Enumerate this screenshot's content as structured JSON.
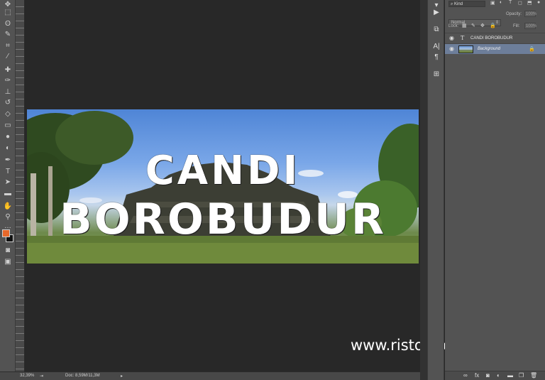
{
  "canvas": {
    "headline_line1": "CANDI",
    "headline_line2": "BOROBUDUR",
    "watermark": "www.ristofa.com"
  },
  "status_bar": {
    "zoom": "32,39%",
    "doc_info": "Doc: 8,59M/11,3M"
  },
  "layers_panel": {
    "filter_kind": "Kind",
    "blend_mode": "Normal",
    "opacity_label": "Opacity:",
    "opacity_value": "100%",
    "lock_label": "Lock:",
    "fill_label": "Fill:",
    "fill_value": "100%",
    "layers": [
      {
        "name": "CANDI BOROBUDUR",
        "type_icon": "T",
        "visible": true,
        "selected": false
      },
      {
        "name": "Background",
        "visible": true,
        "selected": true,
        "locked": true
      }
    ]
  },
  "toolbar": {
    "tools": [
      "move-tool",
      "marquee-tool",
      "lasso-tool",
      "quick-select-tool",
      "crop-tool",
      "eyedropper-tool",
      "healing-brush-tool",
      "brush-tool",
      "clone-stamp-tool",
      "history-brush-tool",
      "eraser-tool",
      "gradient-tool",
      "blur-tool",
      "dodge-tool",
      "pen-tool",
      "type-tool",
      "path-select-tool",
      "shape-tool",
      "hand-tool",
      "zoom-tool"
    ],
    "foreground_color": "#e8682a",
    "background_color": "#111111"
  },
  "colors": {
    "panel": "#535353",
    "workspace": "#282828",
    "selected_layer": "#6d7e9a"
  }
}
